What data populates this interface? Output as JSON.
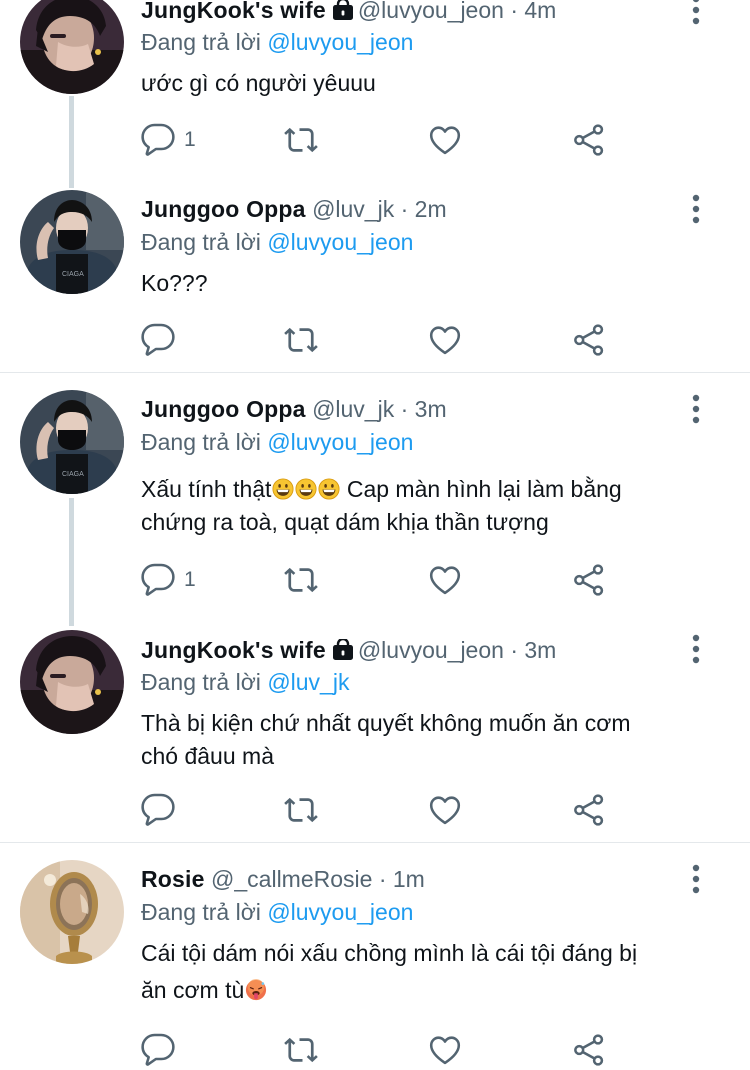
{
  "colors": {
    "link": "#1d9bf0",
    "secondary": "#536471",
    "thread_line": "#cfd9de"
  },
  "icons": [
    "more-vertical-icon",
    "reply-icon",
    "retweet-icon",
    "like-icon",
    "share-icon",
    "lock-icon",
    "grinning-emoji",
    "hot-face-emoji"
  ],
  "tweets": [
    {
      "name": "JungKook's wife",
      "protected": true,
      "handle": "@luvyou_jeon",
      "time": "4m",
      "reply_label": "Đang trả lời",
      "reply_to": "@luvyou_jeon",
      "text": "ước gì có người yêuuu",
      "reply_count": "1"
    },
    {
      "name": "Junggoo Oppa",
      "handle": "@luv_jk",
      "time": "2m",
      "reply_label": "Đang trả lời",
      "reply_to": "@luvyou_jeon",
      "text": "Ko???",
      "reply_count": ""
    },
    {
      "name": "Junggoo Oppa",
      "handle": "@luv_jk",
      "time": "3m",
      "reply_label": "Đang trả lời",
      "reply_to": "@luvyou_jeon",
      "text_line1_a": "Xấu tính thật",
      "text_line1_b": " Cap màn hình lại làm bằng",
      "text_line2": "chứng ra toà, quạt dám khịa thần tượng",
      "reply_count": "1"
    },
    {
      "name": "JungKook's wife",
      "protected": true,
      "handle": "@luvyou_jeon",
      "time": "3m",
      "reply_label": "Đang trả lời",
      "reply_to": "@luv_jk",
      "text_line1": "Thà bị kiện chứ nhất quyết không muốn ăn cơm",
      "text_line2": "chó đâuu mà",
      "reply_count": ""
    },
    {
      "name": "Rosie",
      "handle": "@_callmeRosie",
      "time": "1m",
      "reply_label": "Đang trả lời",
      "reply_to": "@luvyou_jeon",
      "text_line1": "Cái tội dám nói xấu chồng mình là cái tội đáng bị",
      "text_line2": "ăn cơm tù",
      "reply_count": ""
    }
  ]
}
